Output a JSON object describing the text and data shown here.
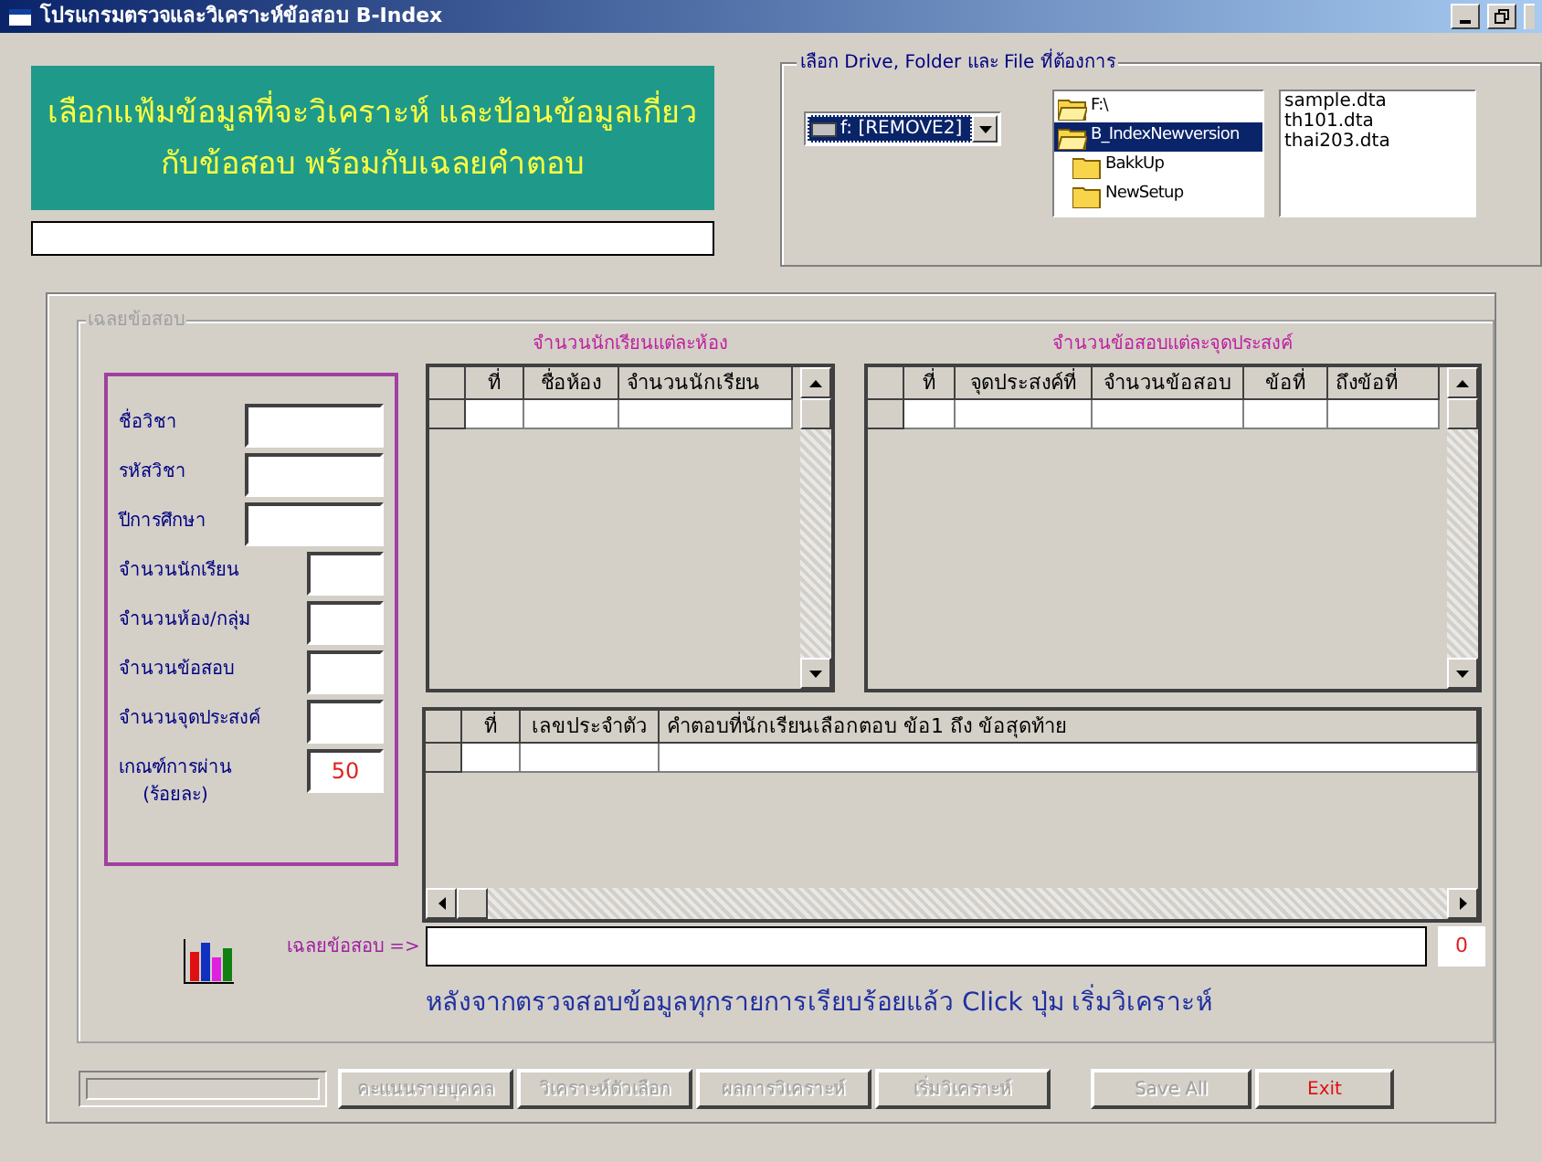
{
  "window": {
    "title": "โปรแกรมตรวจและวิเคราะห์ข้อสอบ B-Index"
  },
  "banner": {
    "lines": [
      "เลือกแฟ้มข้อมูลที่จะวิเคราะห์ และป้อนข้อมูลเกี่ยว",
      "กับข้อสอบ พร้อมกับเฉลยคำตอบ"
    ]
  },
  "file_picker": {
    "title": "เลือก Drive, Folder และ File ที่ต้องการ",
    "drive": "f: [REMOVE2]",
    "folders": [
      {
        "name": "F:\\",
        "open": true,
        "selected": false
      },
      {
        "name": "B_IndexNewversion",
        "open": true,
        "selected": true
      },
      {
        "name": "BakkUp",
        "open": false,
        "selected": false
      },
      {
        "name": "NewSetup",
        "open": false,
        "selected": false
      }
    ],
    "files": [
      "sample.dta",
      "th101.dta",
      "thai203.dta"
    ]
  },
  "answer_key": {
    "title": "เฉลยข้อสอบ",
    "fields": [
      {
        "label": "ชื่อวิชา",
        "kind": "wide"
      },
      {
        "label": "รหัสวิชา",
        "kind": "wide"
      },
      {
        "label": "ปีการศึกษา",
        "kind": "wide"
      },
      {
        "label": "จำนวนนักเรียน",
        "kind": "narrow"
      },
      {
        "label": "จำนวนห้อง/กลุ่ม",
        "kind": "narrow"
      },
      {
        "label": "จำนวนข้อสอบ",
        "kind": "narrow"
      },
      {
        "label": "จำนวนจุดประสงค์",
        "kind": "narrow"
      },
      {
        "label": "เกณฑ์การผ่าน",
        "note": "(ร้อยละ)",
        "value": "50",
        "kind": "narrow"
      }
    ],
    "rooms_table": {
      "title": "จำนวนนักเรียนแต่ละห้อง",
      "columns": [
        "ที่",
        "ชื่อห้อง",
        "จำนวนนักเรียน"
      ]
    },
    "objectives_table": {
      "title": "จำนวนข้อสอบแต่ละจุดประสงค์",
      "columns": [
        "ที่",
        "จุดประสงค์ที่",
        "จำนวนข้อสอบ",
        "ข้อที่",
        "ถึงข้อที่"
      ]
    },
    "answers_table": {
      "columns": [
        "ที่",
        "เลขประจำตัว",
        "คำตอบที่นักเรียนเลือกตอบ ข้อ1 ถึง ข้อสุดท้าย"
      ]
    },
    "answer_line": {
      "label": "เฉลยข้อสอบ =>",
      "count": "0"
    },
    "instruction": "หลังจากตรวจสอบข้อมูลทุกรายการเรียบร้อยแล้ว Click ปุ่ม เริ่มวิเคราะห์"
  },
  "progress": {
    "level": 0
  },
  "buttons": [
    {
      "label": "คะแนนรายบุคคล",
      "disabled": true
    },
    {
      "label": "วิเคราะห์ตัวเลือก",
      "disabled": true
    },
    {
      "label": "ผลการวิเคราะห์",
      "disabled": true
    },
    {
      "label": "เริ่มวิเคราะห์",
      "disabled": true
    },
    {
      "label": "Save All",
      "disabled": true
    },
    {
      "label": "Exit",
      "disabled": false
    }
  ]
}
